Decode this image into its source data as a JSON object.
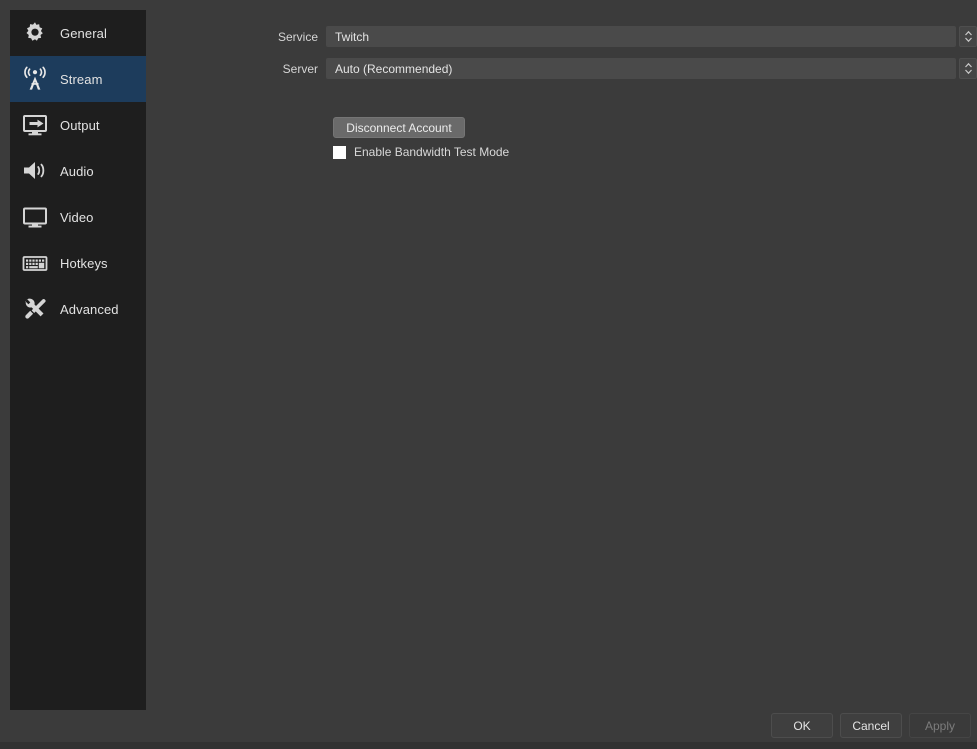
{
  "sidebar": {
    "items": [
      {
        "label": "General",
        "icon": "gear-icon",
        "selected": false
      },
      {
        "label": "Stream",
        "icon": "antenna-icon",
        "selected": true
      },
      {
        "label": "Output",
        "icon": "monitor-arrow-icon",
        "selected": false
      },
      {
        "label": "Audio",
        "icon": "speaker-icon",
        "selected": false
      },
      {
        "label": "Video",
        "icon": "monitor-icon",
        "selected": false
      },
      {
        "label": "Hotkeys",
        "icon": "keyboard-icon",
        "selected": false
      },
      {
        "label": "Advanced",
        "icon": "tools-icon",
        "selected": false
      }
    ]
  },
  "stream_settings": {
    "service": {
      "label": "Service",
      "value": "Twitch"
    },
    "server": {
      "label": "Server",
      "value": "Auto (Recommended)"
    },
    "disconnect_button": "Disconnect Account",
    "bandwidth_test": {
      "label": "Enable Bandwidth Test Mode",
      "checked": false
    }
  },
  "footer": {
    "ok": "OK",
    "cancel": "Cancel",
    "apply": "Apply",
    "apply_disabled": true
  },
  "colors": {
    "window_background": "#3b3b3b",
    "sidebar_background": "#1e1e1e",
    "selection": "#1d3c5c",
    "field_background": "#4a4a4a",
    "button_background": "#6a6a6a",
    "text": "#d8d8d8",
    "disabled_text": "#7c7c7c"
  }
}
